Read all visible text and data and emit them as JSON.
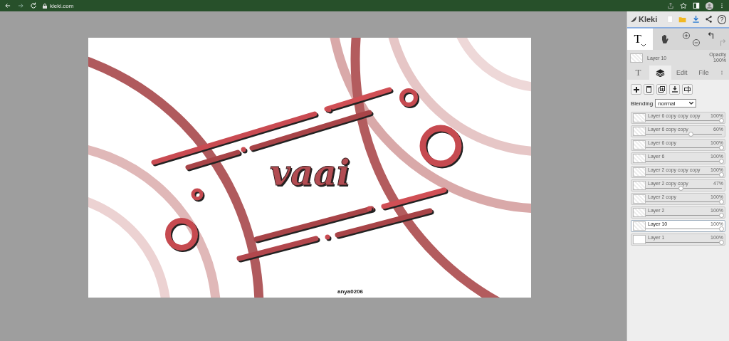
{
  "browser": {
    "url": "kleki.com"
  },
  "canvas": {
    "art_word": "vaai",
    "signature": "anya0206"
  },
  "panel": {
    "app_name": "Kleki",
    "help_glyph": "?",
    "tools": [
      {
        "kind": "text",
        "glyph": "T",
        "selected": true
      },
      {
        "kind": "hand",
        "selected": false
      }
    ],
    "current_layer": {
      "name": "Layer 10",
      "opacity_label": "Opacity",
      "opacity": "100%"
    },
    "tabs": [
      {
        "kind": "text-icon",
        "glyph": "T",
        "selected": false
      },
      {
        "kind": "layers-icon",
        "selected": true
      },
      {
        "kind": "label",
        "label": "Edit",
        "selected": false
      },
      {
        "kind": "label",
        "label": "File",
        "selected": false
      }
    ],
    "blending": {
      "label": "Blending",
      "value": "normal"
    },
    "layers": [
      {
        "name": "Layer 6 copy copy copy",
        "opacity": "100%",
        "level": 1,
        "selected": false
      },
      {
        "name": "Layer 6 copy copy",
        "opacity": "60%",
        "level": 0.6,
        "selected": false
      },
      {
        "name": "Layer 6 copy",
        "opacity": "100%",
        "level": 1,
        "selected": false
      },
      {
        "name": "Layer 6",
        "opacity": "100%",
        "level": 1,
        "selected": false
      },
      {
        "name": "Layer 2 copy copy copy",
        "opacity": "100%",
        "level": 1,
        "selected": false
      },
      {
        "name": "Layer 2 copy copy",
        "opacity": "47%",
        "level": 0.47,
        "selected": false
      },
      {
        "name": "Layer 2 copy",
        "opacity": "100%",
        "level": 1,
        "selected": false
      },
      {
        "name": "Layer 2",
        "opacity": "100%",
        "level": 1,
        "selected": false
      },
      {
        "name": "Layer 10",
        "opacity": "100%",
        "level": 1,
        "selected": true
      },
      {
        "name": "Layer 1",
        "opacity": "100%",
        "level": 1,
        "selected": false
      }
    ]
  }
}
